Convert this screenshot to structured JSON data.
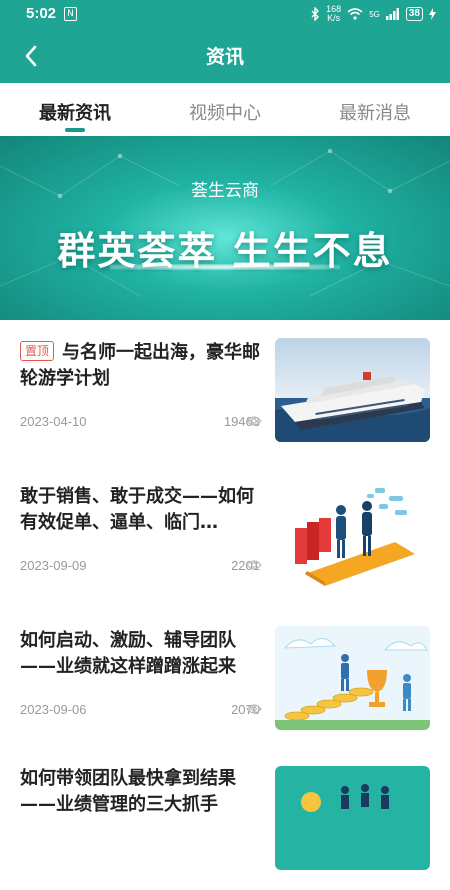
{
  "status_bar": {
    "time": "5:02",
    "nfc": "N",
    "speed_top": "168",
    "speed_bottom": "K/s",
    "network": "5G",
    "battery": "38"
  },
  "header": {
    "title": "资讯"
  },
  "tabs": [
    {
      "label": "最新资讯",
      "active": true
    },
    {
      "label": "视频中心",
      "active": false
    },
    {
      "label": "最新消息",
      "active": false
    }
  ],
  "banner": {
    "subtitle": "荟生云商",
    "headline": "群英荟萃 生生不息"
  },
  "news": [
    {
      "pinned_label": "置顶",
      "title": "与名师一起出海，豪华邮轮游学计划",
      "date": "2023-04-10",
      "views": "19463",
      "image": "cruise-ship"
    },
    {
      "title": "敢于销售、敢于成交——如何有效促单、逼单、临门…",
      "date": "2023-09-09",
      "views": "2201",
      "image": "business-handshake"
    },
    {
      "title": "如何启动、激励、辅导团队——业绩就这样蹭蹭涨起来",
      "date": "2023-09-06",
      "views": "2070",
      "image": "trophy-coins"
    },
    {
      "title": "如何带领团队最快拿到结果——业绩管理的三大抓手",
      "image": "team-goal"
    }
  ],
  "colors": {
    "primary": "#1fa594",
    "badge": "#e05a4f"
  }
}
